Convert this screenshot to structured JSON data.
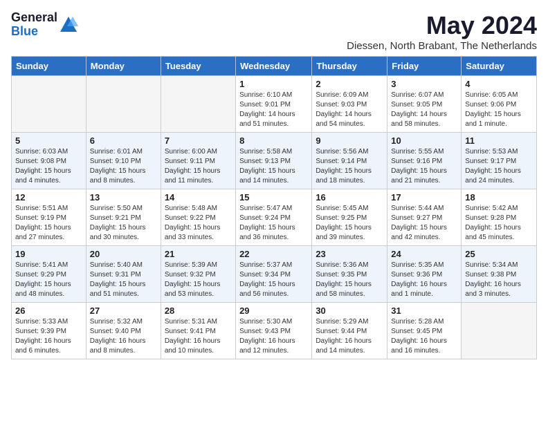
{
  "header": {
    "logo_general": "General",
    "logo_blue": "Blue",
    "month_title": "May 2024",
    "location": "Diessen, North Brabant, The Netherlands"
  },
  "weekdays": [
    "Sunday",
    "Monday",
    "Tuesday",
    "Wednesday",
    "Thursday",
    "Friday",
    "Saturday"
  ],
  "weeks": [
    [
      {
        "day": "",
        "info": ""
      },
      {
        "day": "",
        "info": ""
      },
      {
        "day": "",
        "info": ""
      },
      {
        "day": "1",
        "info": "Sunrise: 6:10 AM\nSunset: 9:01 PM\nDaylight: 14 hours\nand 51 minutes."
      },
      {
        "day": "2",
        "info": "Sunrise: 6:09 AM\nSunset: 9:03 PM\nDaylight: 14 hours\nand 54 minutes."
      },
      {
        "day": "3",
        "info": "Sunrise: 6:07 AM\nSunset: 9:05 PM\nDaylight: 14 hours\nand 58 minutes."
      },
      {
        "day": "4",
        "info": "Sunrise: 6:05 AM\nSunset: 9:06 PM\nDaylight: 15 hours\nand 1 minute."
      }
    ],
    [
      {
        "day": "5",
        "info": "Sunrise: 6:03 AM\nSunset: 9:08 PM\nDaylight: 15 hours\nand 4 minutes."
      },
      {
        "day": "6",
        "info": "Sunrise: 6:01 AM\nSunset: 9:10 PM\nDaylight: 15 hours\nand 8 minutes."
      },
      {
        "day": "7",
        "info": "Sunrise: 6:00 AM\nSunset: 9:11 PM\nDaylight: 15 hours\nand 11 minutes."
      },
      {
        "day": "8",
        "info": "Sunrise: 5:58 AM\nSunset: 9:13 PM\nDaylight: 15 hours\nand 14 minutes."
      },
      {
        "day": "9",
        "info": "Sunrise: 5:56 AM\nSunset: 9:14 PM\nDaylight: 15 hours\nand 18 minutes."
      },
      {
        "day": "10",
        "info": "Sunrise: 5:55 AM\nSunset: 9:16 PM\nDaylight: 15 hours\nand 21 minutes."
      },
      {
        "day": "11",
        "info": "Sunrise: 5:53 AM\nSunset: 9:17 PM\nDaylight: 15 hours\nand 24 minutes."
      }
    ],
    [
      {
        "day": "12",
        "info": "Sunrise: 5:51 AM\nSunset: 9:19 PM\nDaylight: 15 hours\nand 27 minutes."
      },
      {
        "day": "13",
        "info": "Sunrise: 5:50 AM\nSunset: 9:21 PM\nDaylight: 15 hours\nand 30 minutes."
      },
      {
        "day": "14",
        "info": "Sunrise: 5:48 AM\nSunset: 9:22 PM\nDaylight: 15 hours\nand 33 minutes."
      },
      {
        "day": "15",
        "info": "Sunrise: 5:47 AM\nSunset: 9:24 PM\nDaylight: 15 hours\nand 36 minutes."
      },
      {
        "day": "16",
        "info": "Sunrise: 5:45 AM\nSunset: 9:25 PM\nDaylight: 15 hours\nand 39 minutes."
      },
      {
        "day": "17",
        "info": "Sunrise: 5:44 AM\nSunset: 9:27 PM\nDaylight: 15 hours\nand 42 minutes."
      },
      {
        "day": "18",
        "info": "Sunrise: 5:42 AM\nSunset: 9:28 PM\nDaylight: 15 hours\nand 45 minutes."
      }
    ],
    [
      {
        "day": "19",
        "info": "Sunrise: 5:41 AM\nSunset: 9:29 PM\nDaylight: 15 hours\nand 48 minutes."
      },
      {
        "day": "20",
        "info": "Sunrise: 5:40 AM\nSunset: 9:31 PM\nDaylight: 15 hours\nand 51 minutes."
      },
      {
        "day": "21",
        "info": "Sunrise: 5:39 AM\nSunset: 9:32 PM\nDaylight: 15 hours\nand 53 minutes."
      },
      {
        "day": "22",
        "info": "Sunrise: 5:37 AM\nSunset: 9:34 PM\nDaylight: 15 hours\nand 56 minutes."
      },
      {
        "day": "23",
        "info": "Sunrise: 5:36 AM\nSunset: 9:35 PM\nDaylight: 15 hours\nand 58 minutes."
      },
      {
        "day": "24",
        "info": "Sunrise: 5:35 AM\nSunset: 9:36 PM\nDaylight: 16 hours\nand 1 minute."
      },
      {
        "day": "25",
        "info": "Sunrise: 5:34 AM\nSunset: 9:38 PM\nDaylight: 16 hours\nand 3 minutes."
      }
    ],
    [
      {
        "day": "26",
        "info": "Sunrise: 5:33 AM\nSunset: 9:39 PM\nDaylight: 16 hours\nand 6 minutes."
      },
      {
        "day": "27",
        "info": "Sunrise: 5:32 AM\nSunset: 9:40 PM\nDaylight: 16 hours\nand 8 minutes."
      },
      {
        "day": "28",
        "info": "Sunrise: 5:31 AM\nSunset: 9:41 PM\nDaylight: 16 hours\nand 10 minutes."
      },
      {
        "day": "29",
        "info": "Sunrise: 5:30 AM\nSunset: 9:43 PM\nDaylight: 16 hours\nand 12 minutes."
      },
      {
        "day": "30",
        "info": "Sunrise: 5:29 AM\nSunset: 9:44 PM\nDaylight: 16 hours\nand 14 minutes."
      },
      {
        "day": "31",
        "info": "Sunrise: 5:28 AM\nSunset: 9:45 PM\nDaylight: 16 hours\nand 16 minutes."
      },
      {
        "day": "",
        "info": ""
      }
    ]
  ]
}
